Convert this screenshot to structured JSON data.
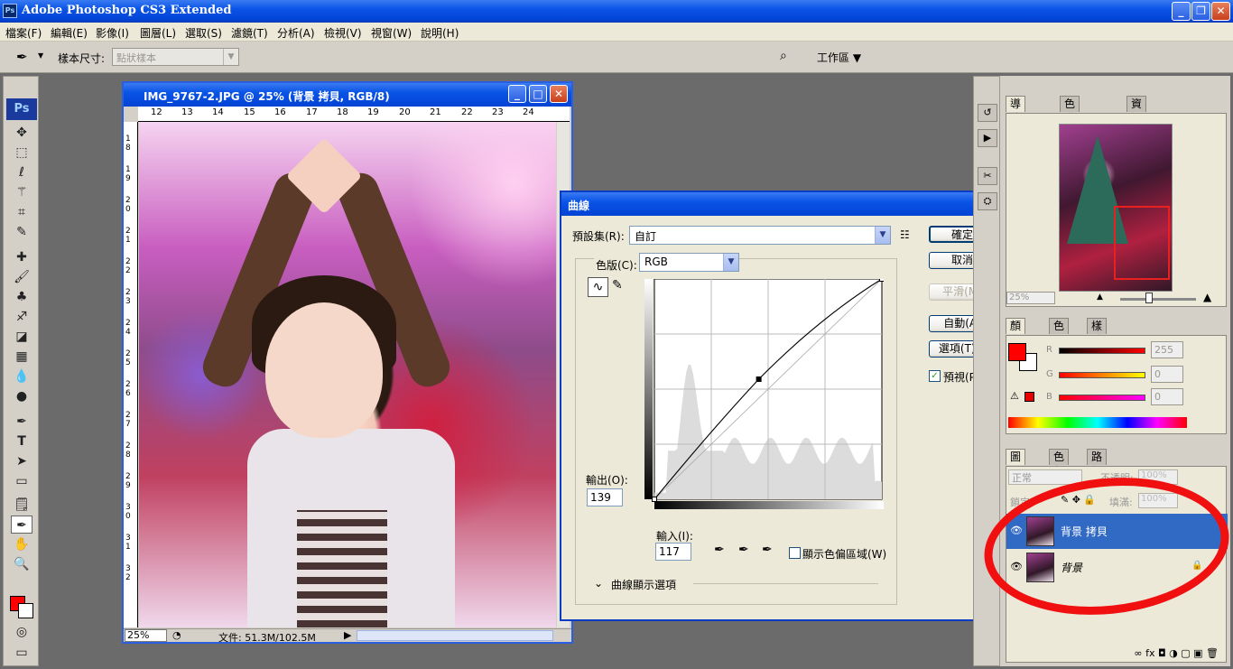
{
  "app": {
    "title": "Adobe Photoshop CS3 Extended",
    "icon_label": "Ps"
  },
  "menu": [
    "檔案(F)",
    "編輯(E)",
    "影像(I)",
    "圖層(L)",
    "選取(S)",
    "濾鏡(T)",
    "分析(A)",
    "檢視(V)",
    "視窗(W)",
    "說明(H)"
  ],
  "options_bar": {
    "sample_label": "樣本尺寸:",
    "sample_value": "點狀樣本",
    "workspace": "工作區 ▼"
  },
  "toolbox": {
    "logo": "Ps"
  },
  "document": {
    "title": "IMG_9767-2.JPG @ 25% (背景 拷貝, RGB/8)",
    "zoom": "25%",
    "file_info": "文件: 51.3M/102.5M",
    "ruler_h": [
      "12",
      "13",
      "14",
      "15",
      "16",
      "17",
      "18",
      "19",
      "20",
      "21",
      "22",
      "23",
      "24"
    ],
    "ruler_v": [
      "1",
      "8",
      "1",
      "9",
      "2",
      "0",
      "2",
      "1",
      "2",
      "2",
      "2",
      "3",
      "2",
      "4",
      "2",
      "5",
      "2",
      "6",
      "2",
      "7",
      "2",
      "8",
      "2",
      "9",
      "3",
      "0",
      "3",
      "1",
      "3",
      "2"
    ]
  },
  "curves": {
    "title": "曲線",
    "preset_label": "預設集(R):",
    "preset_value": "自訂",
    "channel_label": "色版(C):",
    "channel_value": "RGB",
    "output_label": "輸出(O):",
    "output_value": "139",
    "input_label": "輸入(I):",
    "input_value": "117",
    "show_clipping": "顯示色偏區域(W)",
    "display_options": "曲線顯示選項",
    "buttons": {
      "ok": "確定",
      "cancel": "取消",
      "smooth": "平滑(M)",
      "auto": "自動(A)",
      "options": "選項(T)...",
      "preview": "預視(P)"
    },
    "curve_points": [
      [
        0,
        0
      ],
      [
        117,
        139
      ],
      [
        255,
        255
      ]
    ]
  },
  "navigator": {
    "tabs": [
      "導覽器",
      "色階分佈圖",
      "資訊"
    ],
    "zoom": "25%"
  },
  "color_panel": {
    "tabs": [
      "顏色",
      "色票",
      "樣式"
    ],
    "r_label": "R",
    "g_label": "G",
    "b_label": "B",
    "r_value": "255",
    "g_value": "0",
    "b_value": "0",
    "fg": "#ff0000"
  },
  "layers_panel": {
    "tabs": [
      "圖層",
      "色版",
      "路徑"
    ],
    "blend_mode": "正常",
    "opacity_label": "不透明:",
    "opacity_value": "100%",
    "lock_label": "鎖定:",
    "fill_label": "填滿:",
    "fill_value": "100%",
    "layers": [
      {
        "name": "背景 拷貝",
        "selected": true
      },
      {
        "name": "背景",
        "selected": false,
        "locked": true
      }
    ]
  }
}
